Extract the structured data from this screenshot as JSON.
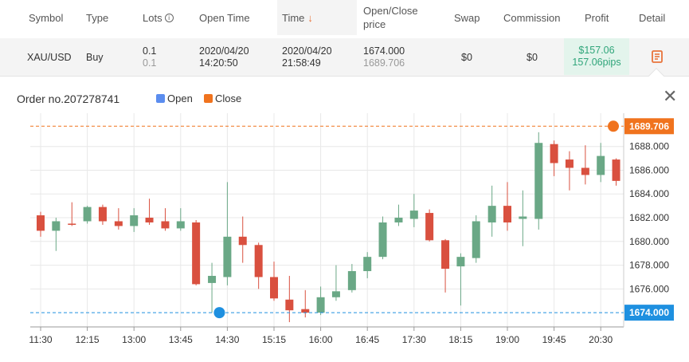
{
  "table": {
    "headers": {
      "symbol": "Symbol",
      "type": "Type",
      "lots": "Lots",
      "open_time": "Open Time",
      "time": "Time",
      "open_close_price_1": "Open/Close",
      "open_close_price_2": "price",
      "swap": "Swap",
      "commission": "Commission",
      "profit": "Profit",
      "detail": "Detail"
    },
    "row": {
      "symbol": "XAU/USD",
      "type": "Buy",
      "lots_open": "0.1",
      "lots_close": "0.1",
      "open_date": "2020/04/20",
      "open_clock": "14:20:50",
      "close_date": "2020/04/20",
      "close_clock": "21:58:49",
      "open_price": "1674.000",
      "close_price": "1689.706",
      "swap": "$0",
      "commission": "$0",
      "profit_usd": "$157.06",
      "profit_pips": "157.06pips"
    }
  },
  "popup": {
    "title": "Order no.207278741",
    "legend_open": "Open",
    "legend_close": "Close",
    "open_color": "#5b8def",
    "close_color": "#f0731e"
  },
  "chart_data": {
    "type": "candlestick",
    "x_ticks": [
      "11:30",
      "12:15",
      "13:00",
      "13:45",
      "14:30",
      "15:15",
      "16:00",
      "16:45",
      "17:30",
      "18:15",
      "19:00",
      "19:45",
      "20:30"
    ],
    "y_ticks": [
      1676,
      1678,
      1680,
      1682,
      1684,
      1686,
      1688
    ],
    "y_tick_labels": [
      "1676.000",
      "1678.000",
      "1680.000",
      "1682.000",
      "1684.000",
      "1686.000",
      "1688.000"
    ],
    "ylim": [
      1672.8,
      1690.8
    ],
    "open_price": 1674.0,
    "close_price": 1689.706,
    "open_label": "1674.000",
    "close_label": "1689.706",
    "up_color": "#6aa886",
    "down_color": "#d9503f",
    "candles": [
      {
        "t": 0.0,
        "o": 1682.2,
        "c": 1680.9,
        "h": 1682.5,
        "l": 1680.4
      },
      {
        "t": 0.33,
        "o": 1680.9,
        "c": 1681.7,
        "h": 1682.0,
        "l": 1679.2
      },
      {
        "t": 0.67,
        "o": 1681.5,
        "c": 1681.4,
        "h": 1683.3,
        "l": 1681.3
      },
      {
        "t": 1.0,
        "o": 1681.7,
        "c": 1682.9,
        "h": 1683.0,
        "l": 1681.5
      },
      {
        "t": 1.33,
        "o": 1682.9,
        "c": 1681.7,
        "h": 1683.1,
        "l": 1681.4
      },
      {
        "t": 1.67,
        "o": 1681.7,
        "c": 1681.3,
        "h": 1682.8,
        "l": 1681.0
      },
      {
        "t": 2.0,
        "o": 1681.3,
        "c": 1682.2,
        "h": 1682.8,
        "l": 1680.8
      },
      {
        "t": 2.33,
        "o": 1682.0,
        "c": 1681.6,
        "h": 1683.6,
        "l": 1681.4
      },
      {
        "t": 2.67,
        "o": 1681.7,
        "c": 1681.1,
        "h": 1682.8,
        "l": 1680.9
      },
      {
        "t": 3.0,
        "o": 1681.1,
        "c": 1681.7,
        "h": 1682.8,
        "l": 1680.9
      },
      {
        "t": 3.33,
        "o": 1681.6,
        "c": 1676.4,
        "h": 1681.8,
        "l": 1676.3
      },
      {
        "t": 3.67,
        "o": 1676.5,
        "c": 1677.1,
        "h": 1678.2,
        "l": 1674.0
      },
      {
        "t": 4.0,
        "o": 1677.0,
        "c": 1680.4,
        "h": 1685.0,
        "l": 1676.3
      },
      {
        "t": 4.33,
        "o": 1680.4,
        "c": 1679.7,
        "h": 1682.1,
        "l": 1678.2
      },
      {
        "t": 4.67,
        "o": 1679.7,
        "c": 1677.0,
        "h": 1679.9,
        "l": 1676.0
      },
      {
        "t": 5.0,
        "o": 1677.0,
        "c": 1675.2,
        "h": 1678.3,
        "l": 1675.0
      },
      {
        "t": 5.33,
        "o": 1675.1,
        "c": 1674.2,
        "h": 1677.1,
        "l": 1673.2
      },
      {
        "t": 5.67,
        "o": 1674.3,
        "c": 1674.0,
        "h": 1675.9,
        "l": 1673.6
      },
      {
        "t": 6.0,
        "o": 1674.0,
        "c": 1675.3,
        "h": 1676.2,
        "l": 1673.8
      },
      {
        "t": 6.33,
        "o": 1675.3,
        "c": 1675.8,
        "h": 1678.0,
        "l": 1675.0
      },
      {
        "t": 6.67,
        "o": 1675.9,
        "c": 1677.5,
        "h": 1678.1,
        "l": 1675.7
      },
      {
        "t": 7.0,
        "o": 1677.5,
        "c": 1678.7,
        "h": 1679.1,
        "l": 1676.9
      },
      {
        "t": 7.33,
        "o": 1678.7,
        "c": 1681.6,
        "h": 1682.1,
        "l": 1678.5
      },
      {
        "t": 7.67,
        "o": 1681.6,
        "c": 1682.0,
        "h": 1683.1,
        "l": 1681.3
      },
      {
        "t": 8.0,
        "o": 1681.9,
        "c": 1682.6,
        "h": 1684.0,
        "l": 1681.2
      },
      {
        "t": 8.33,
        "o": 1682.4,
        "c": 1680.1,
        "h": 1682.7,
        "l": 1680.0
      },
      {
        "t": 8.67,
        "o": 1680.1,
        "c": 1677.7,
        "h": 1680.2,
        "l": 1675.7
      },
      {
        "t": 9.0,
        "o": 1677.9,
        "c": 1678.7,
        "h": 1679.0,
        "l": 1674.6
      },
      {
        "t": 9.33,
        "o": 1678.6,
        "c": 1681.7,
        "h": 1682.2,
        "l": 1678.2
      },
      {
        "t": 9.67,
        "o": 1681.6,
        "c": 1683.0,
        "h": 1684.7,
        "l": 1680.4
      },
      {
        "t": 10.0,
        "o": 1683.0,
        "c": 1681.6,
        "h": 1685.0,
        "l": 1680.9
      },
      {
        "t": 10.33,
        "o": 1681.9,
        "c": 1682.1,
        "h": 1684.3,
        "l": 1679.6
      },
      {
        "t": 10.67,
        "o": 1681.9,
        "c": 1688.3,
        "h": 1689.2,
        "l": 1681.0
      },
      {
        "t": 11.0,
        "o": 1688.2,
        "c": 1686.6,
        "h": 1688.5,
        "l": 1685.5
      },
      {
        "t": 11.33,
        "o": 1686.9,
        "c": 1686.2,
        "h": 1687.6,
        "l": 1684.3
      },
      {
        "t": 11.67,
        "o": 1686.2,
        "c": 1685.6,
        "h": 1688.1,
        "l": 1684.8
      },
      {
        "t": 12.0,
        "o": 1685.6,
        "c": 1687.2,
        "h": 1688.3,
        "l": 1685.0
      },
      {
        "t": 12.33,
        "o": 1686.9,
        "c": 1685.1,
        "h": 1687.0,
        "l": 1684.7
      }
    ]
  }
}
